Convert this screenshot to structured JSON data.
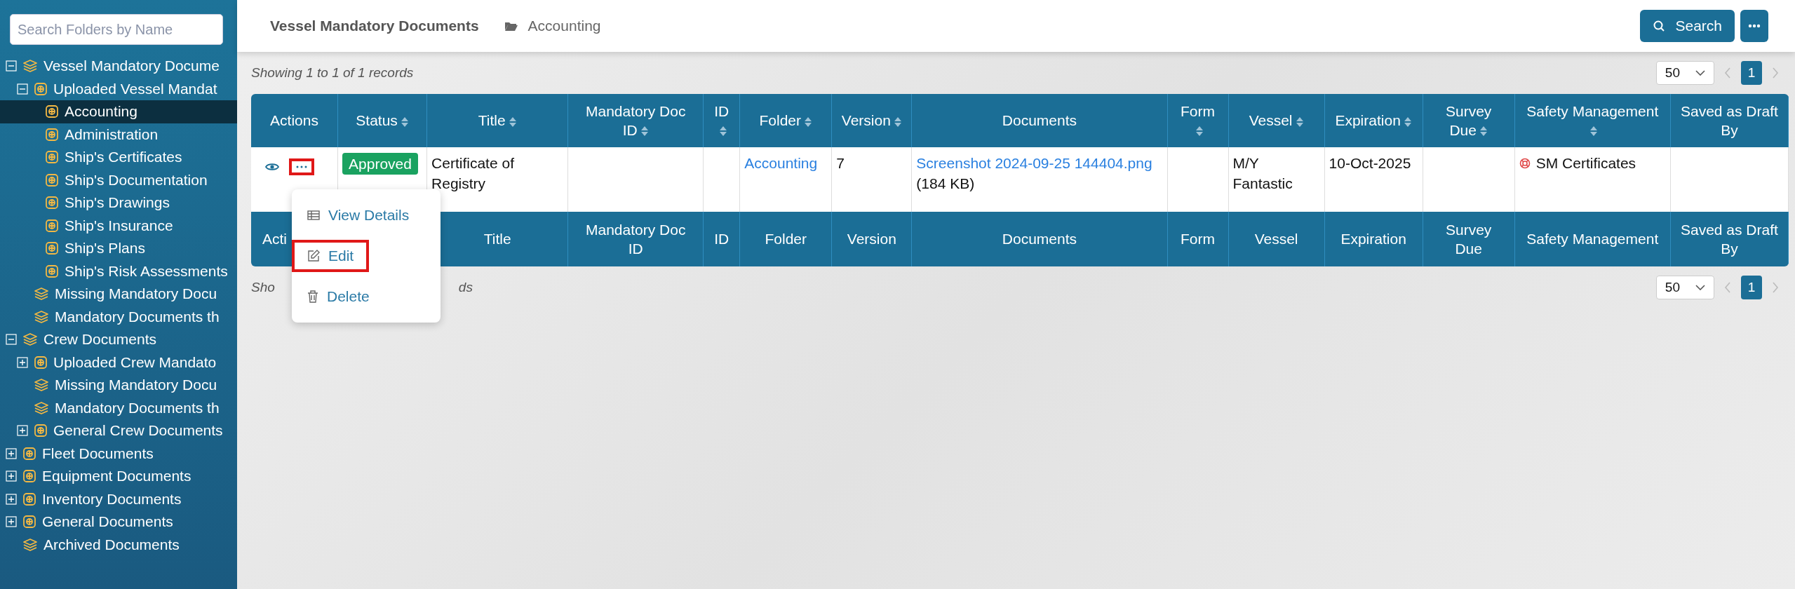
{
  "sidebar": {
    "search": {
      "placeholder": "Search Folders by Name"
    },
    "tree": [
      {
        "label": "Vessel Mandatory Docume",
        "kind": "stack",
        "expanded": true,
        "selected": false,
        "children": [
          {
            "label": "Uploaded Vessel Mandat",
            "kind": "folder",
            "expanded": true,
            "selected": false,
            "children": [
              {
                "label": "Accounting",
                "kind": "folder",
                "selected": true
              },
              {
                "label": "Administration",
                "kind": "folder",
                "selected": false
              },
              {
                "label": "Ship's Certificates",
                "kind": "folder",
                "selected": false
              },
              {
                "label": "Ship's Documentation",
                "kind": "folder",
                "selected": false
              },
              {
                "label": "Ship's Drawings",
                "kind": "folder",
                "selected": false
              },
              {
                "label": "Ship's Insurance",
                "kind": "folder",
                "selected": false
              },
              {
                "label": "Ship's Plans",
                "kind": "folder",
                "selected": false
              },
              {
                "label": "Ship's Risk Assessments",
                "kind": "folder",
                "selected": false
              }
            ]
          },
          {
            "label": "Missing Mandatory Docu",
            "kind": "stack",
            "selected": false
          },
          {
            "label": "Mandatory Documents th",
            "kind": "stack",
            "selected": false
          }
        ]
      },
      {
        "label": "Crew Documents",
        "kind": "stack",
        "expanded": true,
        "selected": false,
        "children": [
          {
            "label": "Uploaded Crew Mandato",
            "kind": "folder",
            "expanded": false,
            "selected": false
          },
          {
            "label": "Missing Mandatory Docu",
            "kind": "stack",
            "selected": false
          },
          {
            "label": "Mandatory Documents th",
            "kind": "stack",
            "selected": false
          },
          {
            "label": "General Crew Documents",
            "kind": "folder",
            "expanded": false,
            "selected": false
          }
        ]
      },
      {
        "label": "Fleet Documents",
        "kind": "folder",
        "expanded": false,
        "selected": false
      },
      {
        "label": "Equipment Documents",
        "kind": "folder",
        "expanded": false,
        "selected": false
      },
      {
        "label": "Inventory Documents",
        "kind": "folder",
        "expanded": false,
        "selected": false
      },
      {
        "label": "General Documents",
        "kind": "folder",
        "expanded": false,
        "selected": false
      },
      {
        "label": "Archived Documents",
        "kind": "stack",
        "selected": false
      }
    ]
  },
  "header": {
    "title": "Vessel Mandatory Documents",
    "breadcrumb": "Accounting",
    "search_button": "Search"
  },
  "top_info": "Showing 1 to 1 of 1 records",
  "pager_top": {
    "page_size": "50",
    "pages": [
      {
        "label": "1",
        "selected": true
      }
    ]
  },
  "table": {
    "columns": [
      {
        "label": "Actions",
        "sortable": false
      },
      {
        "label": "Status",
        "sortable": true
      },
      {
        "label": "Title",
        "sortable": true
      },
      {
        "label": "Mandatory Doc ID",
        "sortable": true
      },
      {
        "label": "ID",
        "sortable": true
      },
      {
        "label": "Folder",
        "sortable": true
      },
      {
        "label": "Version",
        "sortable": true
      },
      {
        "label": "Documents",
        "sortable": false
      },
      {
        "label": "Form",
        "sortable": true
      },
      {
        "label": "Vessel",
        "sortable": true
      },
      {
        "label": "Expiration",
        "sortable": true
      },
      {
        "label": "Survey Due",
        "sortable": true
      },
      {
        "label": "Safety Management",
        "sortable": true
      },
      {
        "label": "Saved as Draft By",
        "sortable": false
      }
    ],
    "rows": [
      {
        "actions_highlighted": true,
        "status": "Approved",
        "title": "Certificate of Registry",
        "folder": "Accounting",
        "version": "7",
        "document_link": "Screenshot 2024-09-25 144404.png",
        "document_size": "(184 KB)",
        "vessel": "M/Y Fantastic",
        "expiration": "10-Oct-2025",
        "safety_management": "SM Certificates"
      }
    ],
    "footer_columns": [
      "Acti",
      "Title",
      "Mandatory Doc ID",
      "ID",
      "Folder",
      "Version",
      "Documents",
      "Form",
      "Vessel",
      "Expiration",
      "Survey Due",
      "Safety Management",
      "Saved as Draft By"
    ]
  },
  "bottom_info": {
    "start": "Sho",
    "end": "ds"
  },
  "pager_bottom": {
    "page_size": "50",
    "pages": [
      {
        "label": "1",
        "selected": true
      }
    ]
  },
  "action_menu": [
    {
      "label": "View Details",
      "kind": "table",
      "highlighted": false
    },
    {
      "label": "Edit",
      "kind": "edit",
      "highlighted": true
    },
    {
      "label": "Delete",
      "kind": "trash",
      "highlighted": false
    }
  ]
}
